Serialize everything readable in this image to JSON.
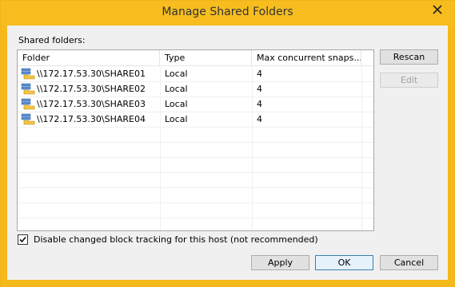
{
  "window": {
    "title": "Manage Shared Folders",
    "close_icon": "close-icon"
  },
  "shared_folders_label": "Shared folders:",
  "table": {
    "columns": [
      "Folder",
      "Type",
      "Max concurrent snaps..."
    ],
    "rows": [
      {
        "folder": "\\\\172.17.53.30\\SHARE01",
        "type": "Local",
        "max": "4"
      },
      {
        "folder": "\\\\172.17.53.30\\SHARE02",
        "type": "Local",
        "max": "4"
      },
      {
        "folder": "\\\\172.17.53.30\\SHARE03",
        "type": "Local",
        "max": "4"
      },
      {
        "folder": "\\\\172.17.53.30\\SHARE04",
        "type": "Local",
        "max": "4"
      }
    ],
    "row_icon": "shared-folder-icon"
  },
  "buttons": {
    "rescan": "Rescan",
    "edit": "Edit",
    "apply": "Apply",
    "ok": "OK",
    "cancel": "Cancel"
  },
  "checkbox": {
    "label": "Disable changed block tracking for this host (not recommended)",
    "checked": true
  },
  "colors": {
    "accent": "#f7bd1f",
    "dialog_bg": "#f0f0f0"
  }
}
